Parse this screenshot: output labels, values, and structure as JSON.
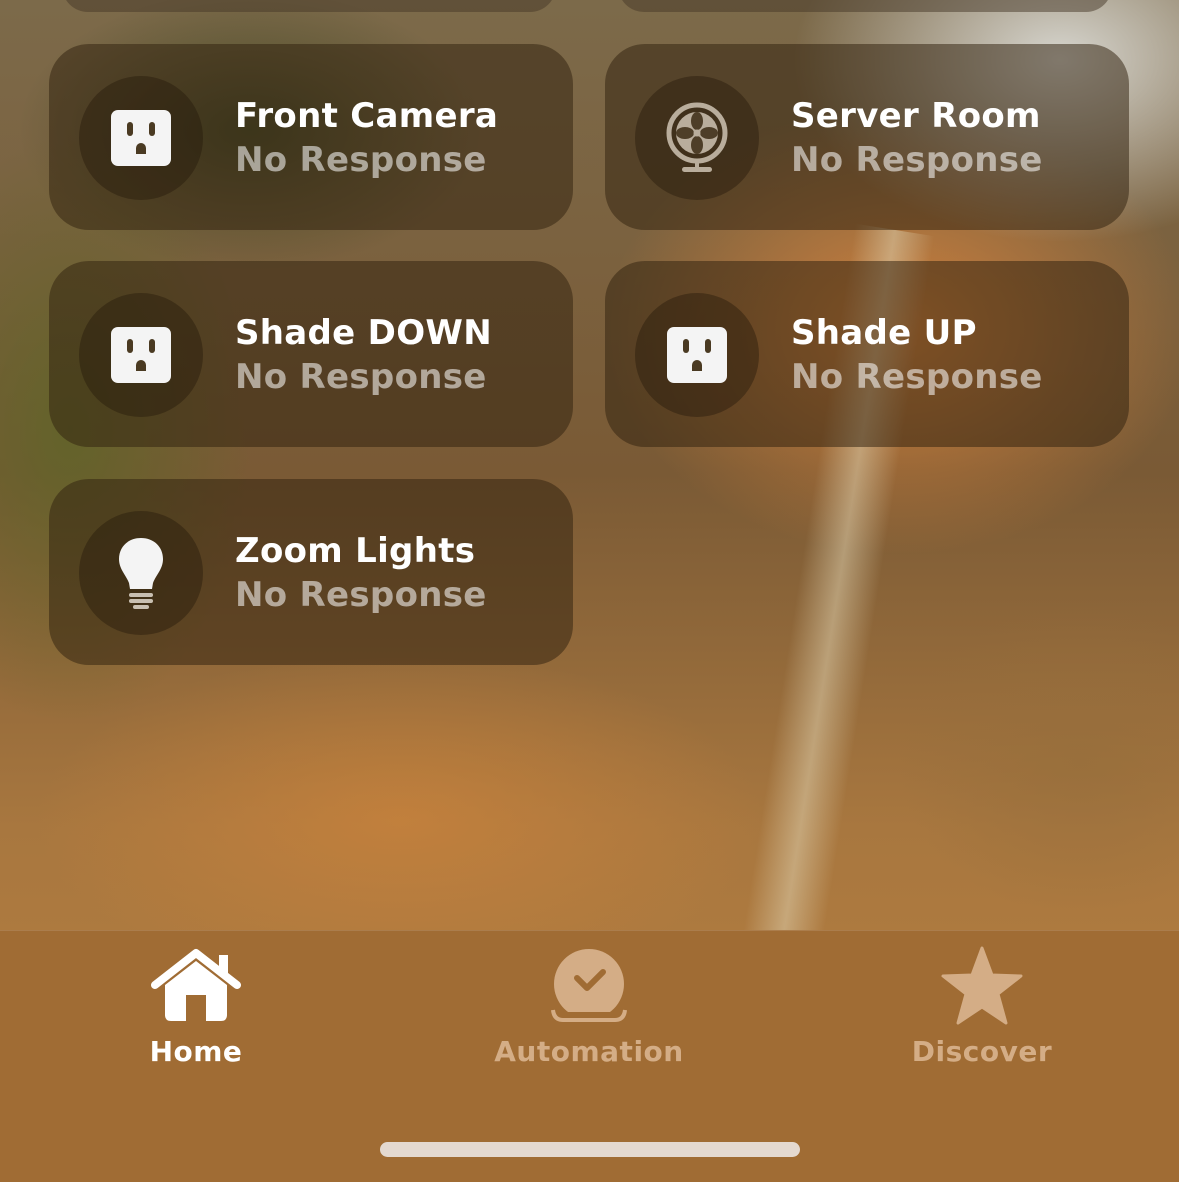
{
  "accessories": [
    {
      "name": "Front Camera",
      "status": "No Response",
      "icon": "outlet-icon"
    },
    {
      "name": "Server Room",
      "status": "No Response",
      "icon": "fan-icon"
    },
    {
      "name": "Shade DOWN",
      "status": "No Response",
      "icon": "outlet-icon"
    },
    {
      "name": "Shade UP",
      "status": "No Response",
      "icon": "outlet-icon"
    },
    {
      "name": "Zoom Lights",
      "status": "No Response",
      "icon": "lightbulb-icon"
    }
  ],
  "tabbar": {
    "tabs": [
      {
        "label": "Home",
        "icon": "house-icon",
        "selected": true
      },
      {
        "label": "Automation",
        "icon": "clock-check-icon",
        "selected": false
      },
      {
        "label": "Discover",
        "icon": "star-icon",
        "selected": false
      }
    ],
    "selected_color": "#ffffff",
    "unselected_color": "#d4ad86"
  }
}
